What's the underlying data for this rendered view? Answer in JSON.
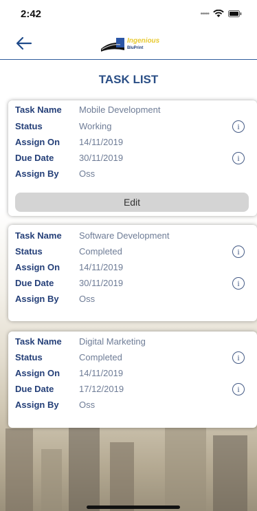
{
  "status_bar": {
    "time": "2:42"
  },
  "header": {
    "logo_top": "Ingenious",
    "logo_bottom": "BluPrint"
  },
  "page_title": "TASK LIST",
  "labels": {
    "task_name": "Task Name",
    "status": "Status",
    "assign_on": "Assign On",
    "due_date": "Due Date",
    "assign_by": "Assign By"
  },
  "tasks": [
    {
      "task_name": "Mobile Development",
      "status": "Working",
      "assign_on": "14/11/2019",
      "due_date": "30/11/2019",
      "assign_by": "Oss",
      "edit_label": "Edit"
    },
    {
      "task_name": "Software Development",
      "status": "Completed",
      "assign_on": "14/11/2019",
      "due_date": "30/11/2019",
      "assign_by": "Oss"
    },
    {
      "task_name": "Digital Marketing",
      "status": "Completed",
      "assign_on": "14/11/2019",
      "due_date": "17/12/2019",
      "assign_by": "Oss"
    }
  ],
  "icons": {
    "info": "i"
  },
  "colors": {
    "label": "#243f78",
    "title": "#2b4f86",
    "value": "#6e7c96",
    "divider": "#2f5d9b"
  }
}
